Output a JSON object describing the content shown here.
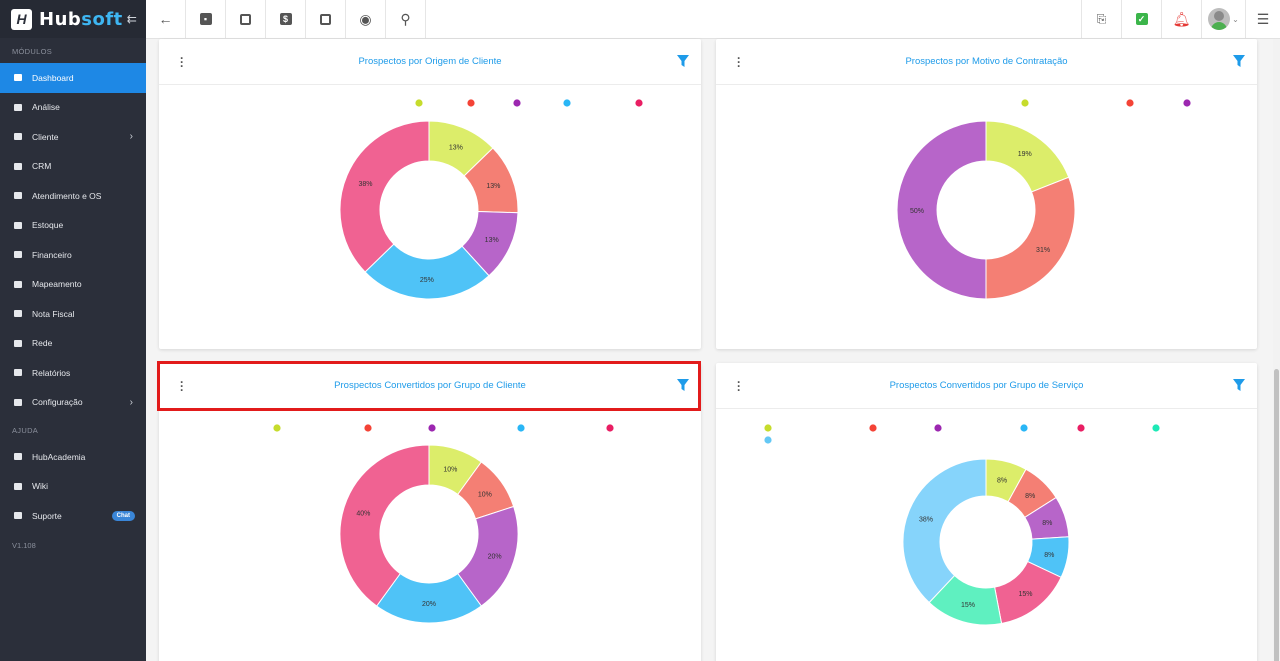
{
  "app": {
    "logo_text_a": "Hub",
    "logo_text_b": "soft",
    "logo_mark": "H"
  },
  "sidebar": {
    "section_modules": "MÓDULOS",
    "items": [
      {
        "label": "Dashboard",
        "icon": "dashboard-icon",
        "active": true
      },
      {
        "label": "Análise",
        "icon": "analysis-icon"
      },
      {
        "label": "Cliente",
        "icon": "client-icon",
        "chevron": true
      },
      {
        "label": "CRM",
        "icon": "crm-icon"
      },
      {
        "label": "Atendimento e OS",
        "icon": "service-order-icon"
      },
      {
        "label": "Estoque",
        "icon": "stock-icon"
      },
      {
        "label": "Financeiro",
        "icon": "finance-icon"
      },
      {
        "label": "Mapeamento",
        "icon": "map-pin-icon"
      },
      {
        "label": "Nota Fiscal",
        "icon": "invoice-icon"
      },
      {
        "label": "Rede",
        "icon": "network-icon"
      },
      {
        "label": "Relatórios",
        "icon": "report-icon"
      },
      {
        "label": "Configuração",
        "icon": "gear-icon",
        "chevron": true
      }
    ],
    "section_help": "AJUDA",
    "help_items": [
      {
        "label": "HubAcademia",
        "icon": "play-icon"
      },
      {
        "label": "Wiki",
        "icon": "wiki-icon"
      },
      {
        "label": "Suporte",
        "icon": "support-icon",
        "badge": "Chat"
      }
    ],
    "version": "V1.108"
  },
  "colors": {
    "accent": "#1e88e5",
    "title": "#1e9be9",
    "highlight": "#e21b1b"
  },
  "chart_data": [
    {
      "type": "pie",
      "title": "Prospectos por Origem de Cliente",
      "legend_colors": [
        "#c6dc2c",
        "#f44336",
        "#9c27b0",
        "#29b6f6",
        "#e91e63"
      ],
      "slices": [
        {
          "value": 13,
          "label": "13%",
          "color": "#dced6a"
        },
        {
          "value": 13,
          "label": "13%",
          "color": "#f47f74"
        },
        {
          "value": 13,
          "label": "13%",
          "color": "#b765c9"
        },
        {
          "value": 25,
          "label": "25%",
          "color": "#4fc3f7"
        },
        {
          "value": 38,
          "label": "38%",
          "color": "#f06292"
        }
      ]
    },
    {
      "type": "pie",
      "title": "Prospectos por Motivo de Contratação",
      "legend_colors": [
        "#c6dc2c",
        "#f44336",
        "#9c27b0"
      ],
      "slices": [
        {
          "value": 19,
          "label": "19%",
          "color": "#dced6a"
        },
        {
          "value": 31,
          "label": "31%",
          "color": "#f47f74"
        },
        {
          "value": 50,
          "label": "50%",
          "color": "#b765c9"
        }
      ]
    },
    {
      "type": "pie",
      "title": "Prospectos Convertidos por Grupo de Cliente",
      "legend_colors": [
        "#c6dc2c",
        "#f44336",
        "#9c27b0",
        "#29b6f6",
        "#e91e63"
      ],
      "slices": [
        {
          "value": 10,
          "label": "10%",
          "color": "#dced6a"
        },
        {
          "value": 10,
          "label": "10%",
          "color": "#f47f74"
        },
        {
          "value": 20,
          "label": "20%",
          "color": "#b765c9"
        },
        {
          "value": 20,
          "label": "20%",
          "color": "#4fc3f7"
        },
        {
          "value": 40,
          "label": "40%",
          "color": "#f06292"
        }
      ]
    },
    {
      "type": "pie",
      "title": "Prospectos Convertidos por Grupo de Serviço",
      "legend_colors": [
        "#c6dc2c",
        "#f44336",
        "#9c27b0",
        "#29b6f6",
        "#e91e63",
        "#1de9b6",
        "#64c8f5"
      ],
      "slices": [
        {
          "value": 8,
          "label": "8%",
          "color": "#dced6a"
        },
        {
          "value": 8,
          "label": "8%",
          "color": "#f47f74"
        },
        {
          "value": 8,
          "label": "8%",
          "color": "#b765c9"
        },
        {
          "value": 8,
          "label": "8%",
          "color": "#4fc3f7"
        },
        {
          "value": 15,
          "label": "15%",
          "color": "#f06292"
        },
        {
          "value": 15,
          "label": "15%",
          "color": "#5ff0c0"
        },
        {
          "value": 38,
          "label": "38%",
          "color": "#86d4fb"
        }
      ]
    }
  ]
}
